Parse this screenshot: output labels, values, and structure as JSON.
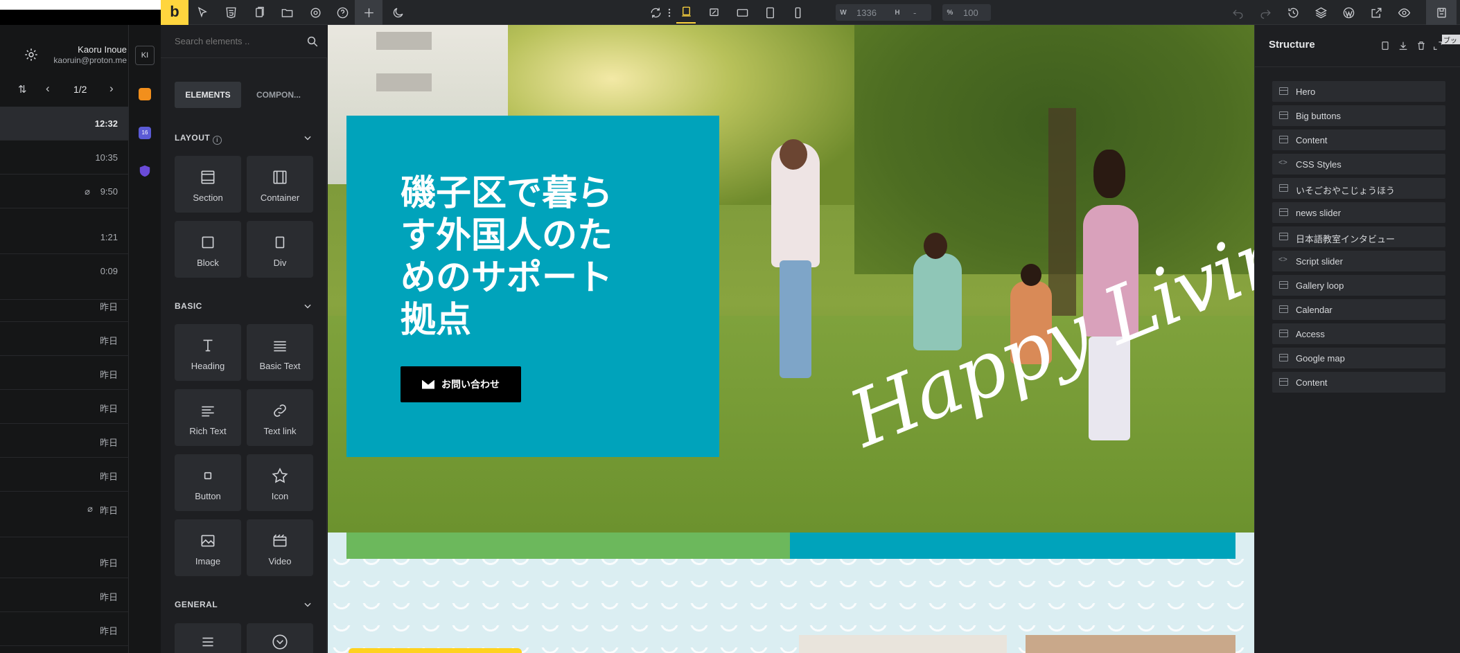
{
  "mail": {
    "user_name": "Kaoru Inoue",
    "user_email": "kaoruin@proton.me",
    "avatar": "KI",
    "pager": "1/2",
    "times": [
      "12:32",
      "10:35",
      "9:50",
      "1:21",
      "0:09",
      "昨日",
      "昨日",
      "昨日",
      "昨日",
      "昨日",
      "昨日",
      "昨日",
      "昨日",
      "昨日",
      "昨日"
    ]
  },
  "elements": {
    "search_placeholder": "Search elements ..",
    "tab_elements": "ELEMENTS",
    "tab_components": "COMPON...",
    "layout_title": "LAYOUT",
    "basic_title": "BASIC",
    "general_title": "GENERAL",
    "layout_items": [
      "Section",
      "Container",
      "Block",
      "Div"
    ],
    "basic_items": [
      "Heading",
      "Basic Text",
      "Rich Text",
      "Text link",
      "Button",
      "Icon",
      "Image",
      "Video"
    ]
  },
  "toolbar": {
    "w_label": "W",
    "w_value": "1336",
    "h_label": "H",
    "h_value": "-",
    "pct_label": "%",
    "pct_value": "100"
  },
  "hero": {
    "heading": "磯子区で暮らす外国人のためのサポート拠点",
    "button_label": "お問い合わせ",
    "script_text": "Happy Living",
    "teal": "#00a3bb",
    "green": "#6cb85c"
  },
  "structure": {
    "title": "Structure",
    "corner_label": "ブッ",
    "items": [
      {
        "label": "Hero",
        "kind": "section"
      },
      {
        "label": "Big buttons",
        "kind": "section"
      },
      {
        "label": "Content",
        "kind": "section"
      },
      {
        "label": "CSS Styles",
        "kind": "code"
      },
      {
        "label": "いそごおやこじょうほう",
        "kind": "section"
      },
      {
        "label": "news slider",
        "kind": "section"
      },
      {
        "label": "日本語教室インタビュー",
        "kind": "section"
      },
      {
        "label": "Script slider",
        "kind": "code"
      },
      {
        "label": "Gallery loop",
        "kind": "section"
      },
      {
        "label": "Calendar",
        "kind": "section"
      },
      {
        "label": "Access",
        "kind": "section"
      },
      {
        "label": "Google map",
        "kind": "section"
      },
      {
        "label": "Content",
        "kind": "section"
      }
    ]
  }
}
